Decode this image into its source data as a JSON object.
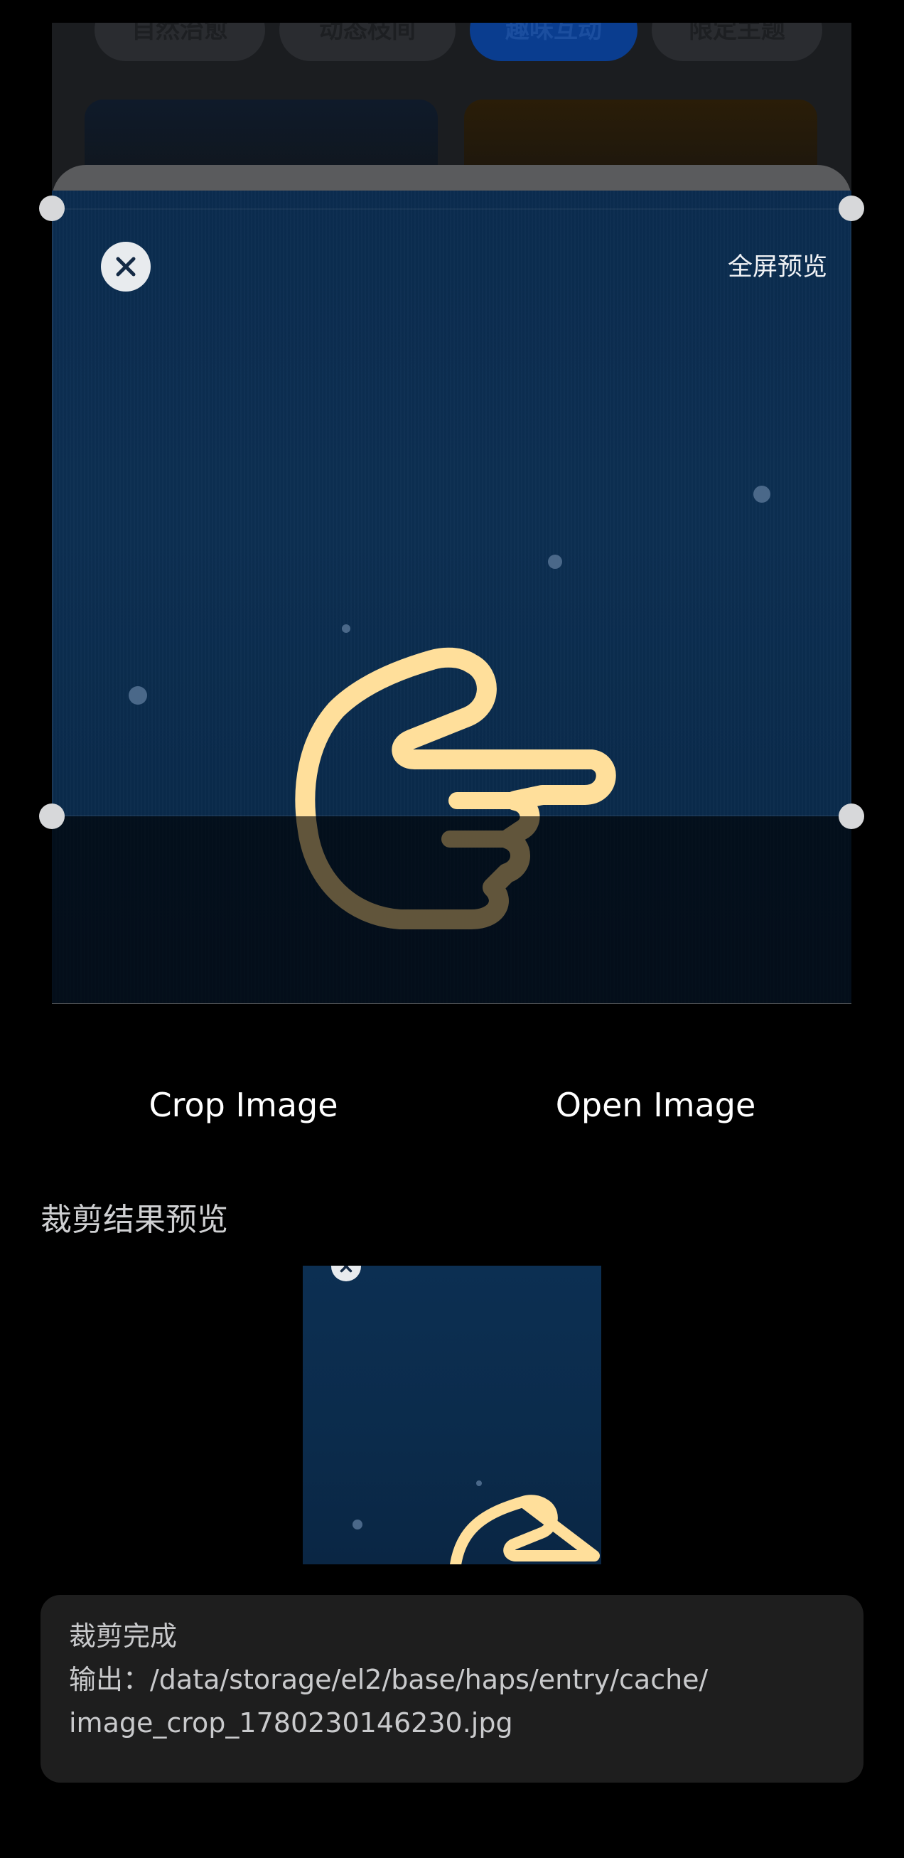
{
  "background_app": {
    "chips": [
      "自然治愈",
      "动态枝间",
      "趣味互动",
      "限定主题"
    ],
    "active_chip_index": 2
  },
  "crop_view": {
    "close_icon": "close-icon",
    "fullscreen_label": "全屏预览",
    "image_icon": "pointing-hand-icon"
  },
  "actions": {
    "crop_label": "Crop Image",
    "open_label": "Open Image"
  },
  "result": {
    "title": "裁剪结果预览"
  },
  "log": {
    "lines": [
      "裁剪完成",
      "输出：/data/storage/el2/base/haps/entry/cache/",
      "image_crop_1780230146230.jpg"
    ]
  },
  "colors": {
    "background": "#000000",
    "image_bg": "#0b2c4f",
    "hand_fill": "#ffe1a0",
    "log_bg": "#1e1e1e"
  }
}
